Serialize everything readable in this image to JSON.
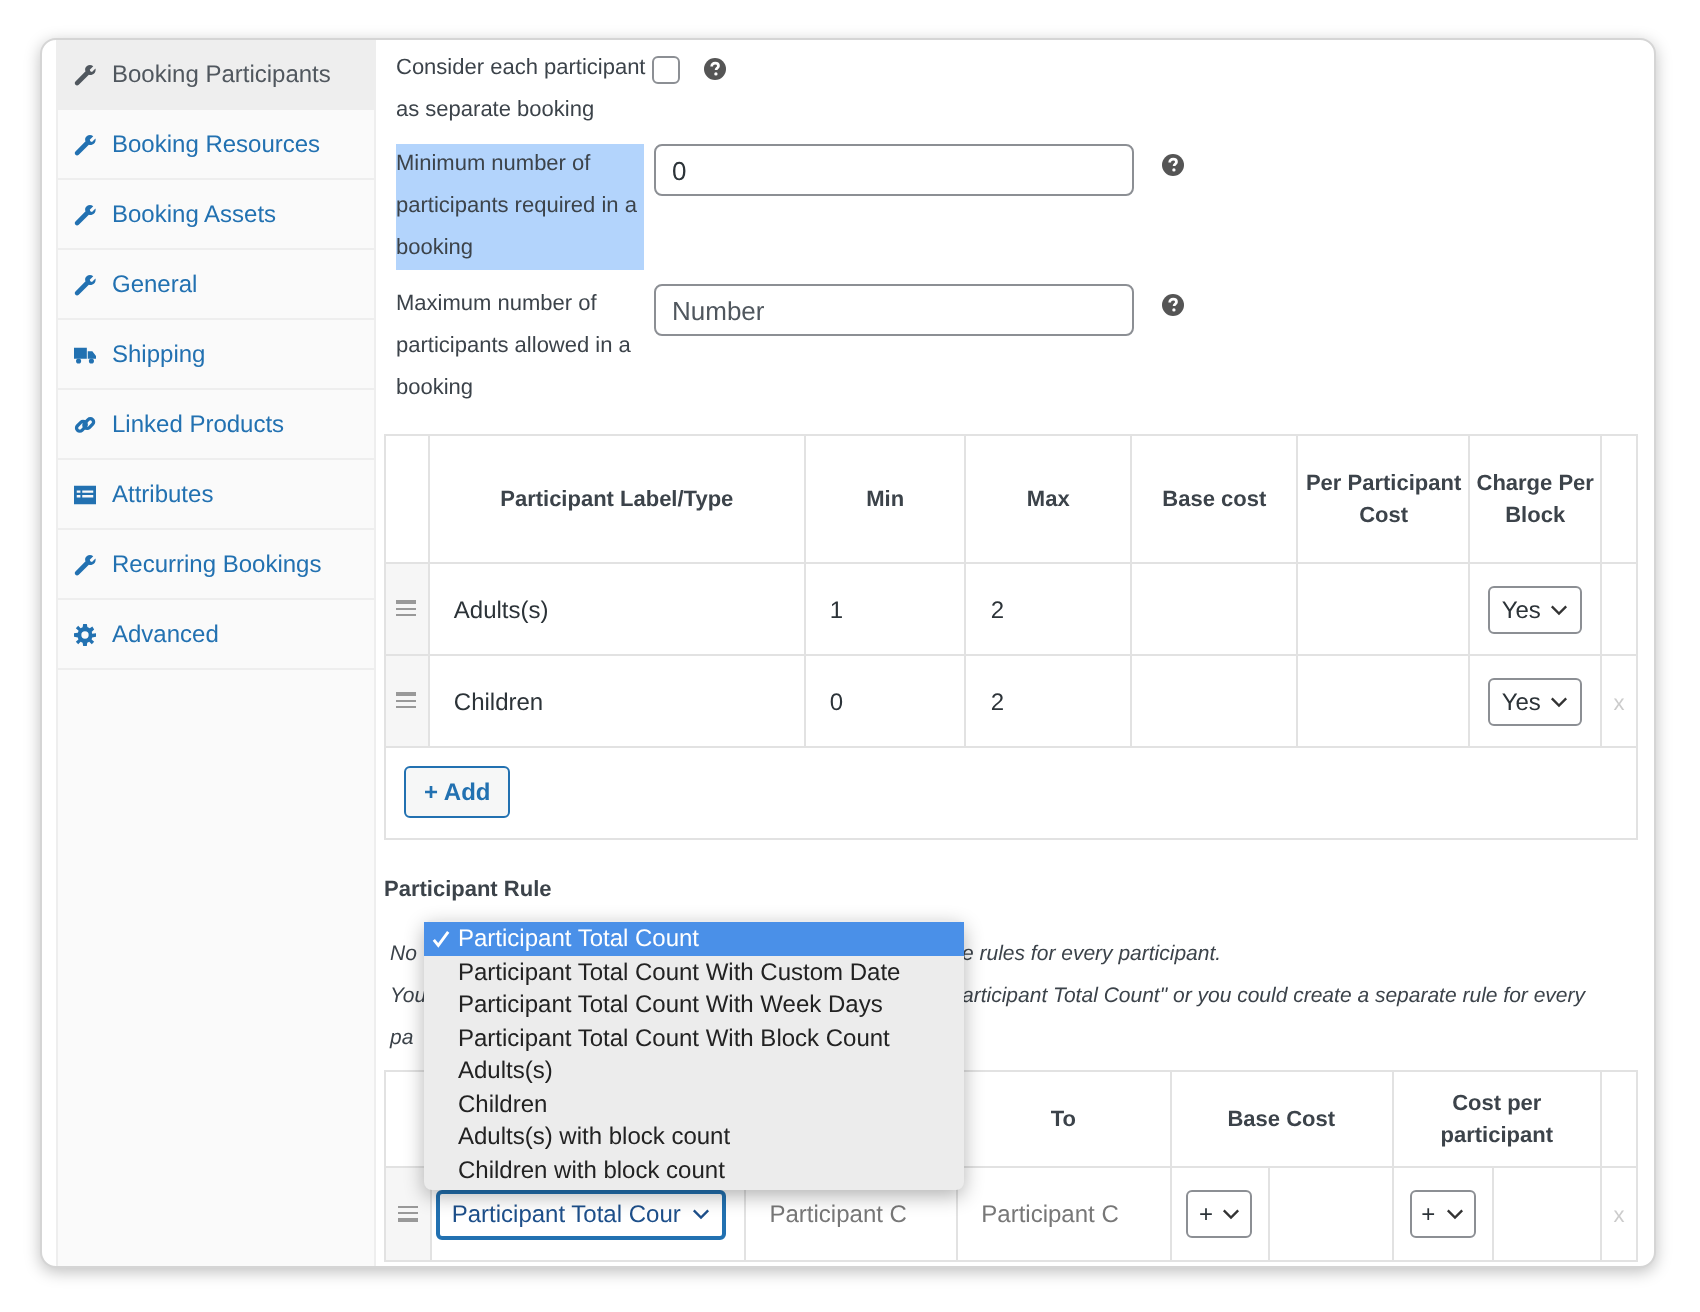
{
  "sidebar": {
    "items": [
      {
        "label": "Booking Participants",
        "kind": "wrench",
        "selected": true
      },
      {
        "label": "Booking Resources",
        "kind": "wrench",
        "selected": false
      },
      {
        "label": "Booking Assets",
        "kind": "wrench",
        "selected": false
      },
      {
        "label": "General",
        "kind": "wrench",
        "selected": false
      },
      {
        "label": "Shipping",
        "kind": "truck",
        "selected": false
      },
      {
        "label": "Linked Products",
        "kind": "link",
        "selected": false
      },
      {
        "label": "Attributes",
        "kind": "list",
        "selected": false
      },
      {
        "label": "Recurring Bookings",
        "kind": "wrench",
        "selected": false
      },
      {
        "label": "Advanced",
        "kind": "gear",
        "selected": false
      }
    ]
  },
  "settings": {
    "separate_booking": {
      "label_lines": [
        "Consider each participant",
        "as separate booking"
      ],
      "checked": false
    },
    "fields": [
      {
        "label": "Minimum number of participants required in a booking",
        "value": "0",
        "text_selected": true
      },
      {
        "label": "Maximum number of participants allowed in a booking",
        "placeholder": "Number",
        "text_selected": false
      }
    ]
  },
  "participants_table": {
    "columns": [
      "Participant Label/Type",
      "Min",
      "Max",
      "Base cost",
      "Per Participant Cost",
      "Charge Per Block"
    ],
    "rows": [
      {
        "label": "Adults(s)",
        "min": "1",
        "max": "2",
        "charge_per_block": "Yes"
      },
      {
        "label": "Children",
        "min": "0",
        "max": "2",
        "charge_per_block": "Yes",
        "remove": "x"
      }
    ],
    "add_button": "+ Add"
  },
  "participant_rule": {
    "title": "Participant Rule",
    "note_lines": [
      {
        "left": "No",
        "right": "e rules for every participant."
      },
      {
        "left": "You",
        "right": "articipant Total Count\" or you could create a separate rule for every"
      },
      {
        "left": "pa"
      }
    ],
    "columns": [
      "To",
      "Base Cost",
      "Cost per participant"
    ],
    "row": {
      "type": "Participant Total Cour",
      "from_placeholder": "Participant C",
      "to_placeholder": "Participant C",
      "base_cost_operator": "+",
      "per_participant_operator": "+",
      "remove": "x"
    },
    "dropdown": {
      "options": [
        {
          "label": "Participant Total Count",
          "selected": true
        },
        {
          "label": "Participant Total Count With Custom Date",
          "selected": false
        },
        {
          "label": "Participant Total Count With Week Days",
          "selected": false
        },
        {
          "label": "Participant Total Count With Block Count",
          "selected": false
        },
        {
          "label": "Adults(s)",
          "selected": false
        },
        {
          "label": "Children",
          "selected": false
        },
        {
          "label": "Adults(s) with block count",
          "selected": false
        },
        {
          "label": "Children with block count",
          "selected": false
        }
      ]
    }
  }
}
